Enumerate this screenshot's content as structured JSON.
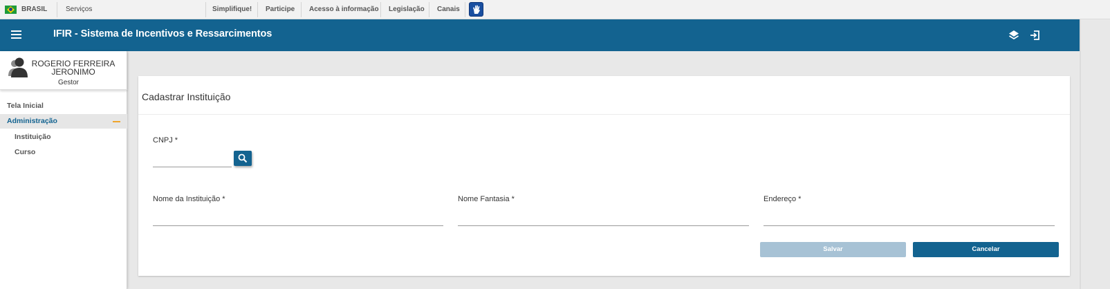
{
  "govbar": {
    "brasil": "BRASIL",
    "servicos": "Serviços",
    "links": [
      "Simplifique!",
      "Participe",
      "Acesso à informação",
      "Legislação",
      "Canais"
    ]
  },
  "header": {
    "title": "IFIR - Sistema de Incentivos e Ressarcimentos",
    "icons": [
      "menu-icon",
      "layers-icon",
      "logout-icon"
    ],
    "color": "#136390"
  },
  "user": {
    "name": "ROGERIO FERREIRA JERONIMO",
    "role": "Gestor"
  },
  "sidebar": {
    "items": [
      {
        "label": "Tela Inicial"
      },
      {
        "label": "Administração"
      },
      {
        "label": "Instituição"
      },
      {
        "label": "Curso"
      }
    ]
  },
  "form": {
    "title": "Cadastrar Instituição",
    "cnpj_label": "CNPJ *",
    "cnpj_value": "",
    "nome_label": "Nome da Instituição *",
    "nome_value": "",
    "fantasia_label": "Nome Fantasia *",
    "fantasia_value": "",
    "endereco_label": "Endereço *",
    "endereco_value": "",
    "save_label": "Salvar",
    "cancel_label": "Cancelar"
  },
  "colors": {
    "primary": "#136390",
    "disabled": "#a7c2d5",
    "accent": "#f0a52a"
  }
}
